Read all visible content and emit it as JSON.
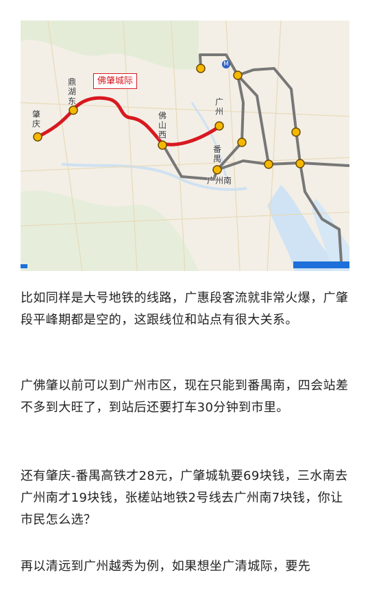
{
  "map": {
    "line_name": "佛肇城际",
    "line_color": "#d71920",
    "other_line_color": "#777777",
    "station_fill": "#f5b800",
    "stations": [
      "肇庆",
      "鼎湖东",
      "佛山西",
      "广州",
      "番禺",
      "广州南"
    ],
    "metro_icon": "metro-icon"
  },
  "article": {
    "paragraphs": [
      "比如同样是大号地铁的线路，广惠段客流就非常火爆，广肇段平峰期都是空的，这跟线位和站点有很大关系。",
      "广佛肇以前可以到广州市区，现在只能到番禺南，四会站差不多到大旺了，到站后还要打车30分钟到市里。",
      "还有肇庆-番禺高铁才28元，广肇城轨要69块钱，三水南去广州南才19块钱，张槎站地铁2号线去广州南7块钱，你让市民怎么选？",
      "再以清远到广州越秀为例，如果想坐广清城际，要先"
    ]
  }
}
